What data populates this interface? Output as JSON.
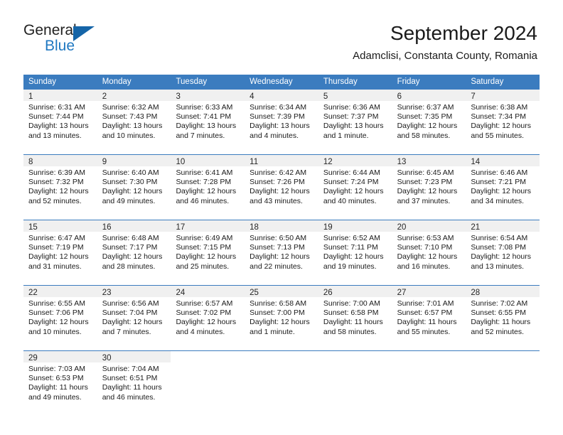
{
  "brand": {
    "line1": "General",
    "line2": "Blue",
    "triangle_color": "#1565a8",
    "text_color_line2": "#1f78c1"
  },
  "header": {
    "title": "September 2024",
    "subtitle": "Adamclisi, Constanta County, Romania"
  },
  "theme": {
    "header_band": "#3b7cbf",
    "day_number_band": "#f0f0f0",
    "text": "#1a1a1a"
  },
  "weekdays": [
    "Sunday",
    "Monday",
    "Tuesday",
    "Wednesday",
    "Thursday",
    "Friday",
    "Saturday"
  ],
  "weeks": [
    [
      {
        "day": "1",
        "lines": [
          "Sunrise: 6:31 AM",
          "Sunset: 7:44 PM",
          "Daylight: 13 hours",
          "and 13 minutes."
        ]
      },
      {
        "day": "2",
        "lines": [
          "Sunrise: 6:32 AM",
          "Sunset: 7:43 PM",
          "Daylight: 13 hours",
          "and 10 minutes."
        ]
      },
      {
        "day": "3",
        "lines": [
          "Sunrise: 6:33 AM",
          "Sunset: 7:41 PM",
          "Daylight: 13 hours",
          "and 7 minutes."
        ]
      },
      {
        "day": "4",
        "lines": [
          "Sunrise: 6:34 AM",
          "Sunset: 7:39 PM",
          "Daylight: 13 hours",
          "and 4 minutes."
        ]
      },
      {
        "day": "5",
        "lines": [
          "Sunrise: 6:36 AM",
          "Sunset: 7:37 PM",
          "Daylight: 13 hours",
          "and 1 minute."
        ]
      },
      {
        "day": "6",
        "lines": [
          "Sunrise: 6:37 AM",
          "Sunset: 7:35 PM",
          "Daylight: 12 hours",
          "and 58 minutes."
        ]
      },
      {
        "day": "7",
        "lines": [
          "Sunrise: 6:38 AM",
          "Sunset: 7:34 PM",
          "Daylight: 12 hours",
          "and 55 minutes."
        ]
      }
    ],
    [
      {
        "day": "8",
        "lines": [
          "Sunrise: 6:39 AM",
          "Sunset: 7:32 PM",
          "Daylight: 12 hours",
          "and 52 minutes."
        ]
      },
      {
        "day": "9",
        "lines": [
          "Sunrise: 6:40 AM",
          "Sunset: 7:30 PM",
          "Daylight: 12 hours",
          "and 49 minutes."
        ]
      },
      {
        "day": "10",
        "lines": [
          "Sunrise: 6:41 AM",
          "Sunset: 7:28 PM",
          "Daylight: 12 hours",
          "and 46 minutes."
        ]
      },
      {
        "day": "11",
        "lines": [
          "Sunrise: 6:42 AM",
          "Sunset: 7:26 PM",
          "Daylight: 12 hours",
          "and 43 minutes."
        ]
      },
      {
        "day": "12",
        "lines": [
          "Sunrise: 6:44 AM",
          "Sunset: 7:24 PM",
          "Daylight: 12 hours",
          "and 40 minutes."
        ]
      },
      {
        "day": "13",
        "lines": [
          "Sunrise: 6:45 AM",
          "Sunset: 7:23 PM",
          "Daylight: 12 hours",
          "and 37 minutes."
        ]
      },
      {
        "day": "14",
        "lines": [
          "Sunrise: 6:46 AM",
          "Sunset: 7:21 PM",
          "Daylight: 12 hours",
          "and 34 minutes."
        ]
      }
    ],
    [
      {
        "day": "15",
        "lines": [
          "Sunrise: 6:47 AM",
          "Sunset: 7:19 PM",
          "Daylight: 12 hours",
          "and 31 minutes."
        ]
      },
      {
        "day": "16",
        "lines": [
          "Sunrise: 6:48 AM",
          "Sunset: 7:17 PM",
          "Daylight: 12 hours",
          "and 28 minutes."
        ]
      },
      {
        "day": "17",
        "lines": [
          "Sunrise: 6:49 AM",
          "Sunset: 7:15 PM",
          "Daylight: 12 hours",
          "and 25 minutes."
        ]
      },
      {
        "day": "18",
        "lines": [
          "Sunrise: 6:50 AM",
          "Sunset: 7:13 PM",
          "Daylight: 12 hours",
          "and 22 minutes."
        ]
      },
      {
        "day": "19",
        "lines": [
          "Sunrise: 6:52 AM",
          "Sunset: 7:11 PM",
          "Daylight: 12 hours",
          "and 19 minutes."
        ]
      },
      {
        "day": "20",
        "lines": [
          "Sunrise: 6:53 AM",
          "Sunset: 7:10 PM",
          "Daylight: 12 hours",
          "and 16 minutes."
        ]
      },
      {
        "day": "21",
        "lines": [
          "Sunrise: 6:54 AM",
          "Sunset: 7:08 PM",
          "Daylight: 12 hours",
          "and 13 minutes."
        ]
      }
    ],
    [
      {
        "day": "22",
        "lines": [
          "Sunrise: 6:55 AM",
          "Sunset: 7:06 PM",
          "Daylight: 12 hours",
          "and 10 minutes."
        ]
      },
      {
        "day": "23",
        "lines": [
          "Sunrise: 6:56 AM",
          "Sunset: 7:04 PM",
          "Daylight: 12 hours",
          "and 7 minutes."
        ]
      },
      {
        "day": "24",
        "lines": [
          "Sunrise: 6:57 AM",
          "Sunset: 7:02 PM",
          "Daylight: 12 hours",
          "and 4 minutes."
        ]
      },
      {
        "day": "25",
        "lines": [
          "Sunrise: 6:58 AM",
          "Sunset: 7:00 PM",
          "Daylight: 12 hours",
          "and 1 minute."
        ]
      },
      {
        "day": "26",
        "lines": [
          "Sunrise: 7:00 AM",
          "Sunset: 6:58 PM",
          "Daylight: 11 hours",
          "and 58 minutes."
        ]
      },
      {
        "day": "27",
        "lines": [
          "Sunrise: 7:01 AM",
          "Sunset: 6:57 PM",
          "Daylight: 11 hours",
          "and 55 minutes."
        ]
      },
      {
        "day": "28",
        "lines": [
          "Sunrise: 7:02 AM",
          "Sunset: 6:55 PM",
          "Daylight: 11 hours",
          "and 52 minutes."
        ]
      }
    ],
    [
      {
        "day": "29",
        "lines": [
          "Sunrise: 7:03 AM",
          "Sunset: 6:53 PM",
          "Daylight: 11 hours",
          "and 49 minutes."
        ]
      },
      {
        "day": "30",
        "lines": [
          "Sunrise: 7:04 AM",
          "Sunset: 6:51 PM",
          "Daylight: 11 hours",
          "and 46 minutes."
        ]
      },
      {
        "day": "",
        "lines": []
      },
      {
        "day": "",
        "lines": []
      },
      {
        "day": "",
        "lines": []
      },
      {
        "day": "",
        "lines": []
      },
      {
        "day": "",
        "lines": []
      }
    ]
  ]
}
